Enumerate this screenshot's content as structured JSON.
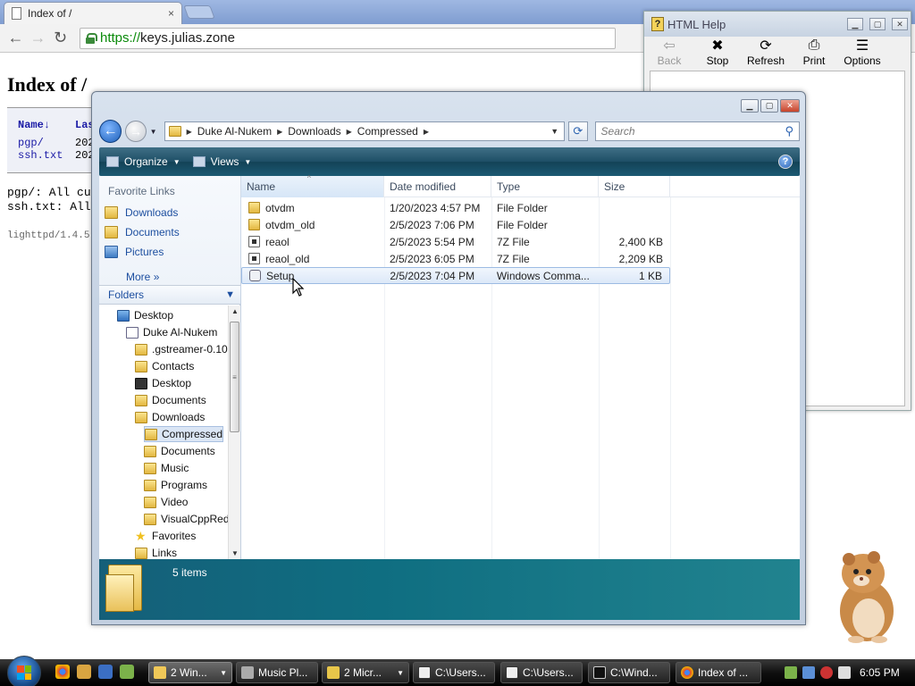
{
  "browser": {
    "tab_title": "Index of /",
    "tab_close": "×",
    "url_scheme": "https://",
    "url_host": "keys.julias.zone",
    "back_glyph": "←",
    "forward_glyph": "→",
    "reload_glyph": "↻"
  },
  "page": {
    "heading": "Index of /",
    "table_headers": [
      "Name↓",
      "Las"
    ],
    "rows": [
      {
        "name": "pgp/",
        "date": "202"
      },
      {
        "name": "ssh.txt",
        "date": "202"
      }
    ],
    "readme_lines": [
      "pgp/: All cu",
      "ssh.txt: All"
    ],
    "footer": "lighttpd/1.4.5"
  },
  "help_window": {
    "title": "HTML Help",
    "tools": [
      {
        "label": "Back",
        "icon": "back-arrow-icon",
        "glyph": "⇦",
        "enabled": false
      },
      {
        "label": "Stop",
        "icon": "stop-icon",
        "glyph": "✖",
        "enabled": true
      },
      {
        "label": "Refresh",
        "icon": "refresh-icon",
        "glyph": "⟳",
        "enabled": true
      },
      {
        "label": "Print",
        "icon": "print-icon",
        "glyph": "⎙",
        "enabled": true
      },
      {
        "label": "Options",
        "icon": "options-icon",
        "glyph": "☰",
        "enabled": true
      }
    ]
  },
  "explorer": {
    "breadcrumb": [
      "Duke Al-Nukem",
      "Downloads",
      "Compressed"
    ],
    "search_placeholder": "Search",
    "commands": {
      "organize": "Organize",
      "views": "Views"
    },
    "favorite_links_title": "Favorite Links",
    "favorite_links": [
      "Downloads",
      "Documents",
      "Pictures"
    ],
    "more_label": "More",
    "folders_label": "Folders",
    "tree": [
      {
        "label": "Desktop",
        "indent": 0,
        "icon": "desktop"
      },
      {
        "label": "Duke Al-Nukem",
        "indent": 1,
        "icon": "user"
      },
      {
        "label": ".gstreamer-0.10",
        "indent": 2,
        "icon": "folder"
      },
      {
        "label": "Contacts",
        "indent": 2,
        "icon": "folder"
      },
      {
        "label": "Desktop",
        "indent": 2,
        "icon": "dark"
      },
      {
        "label": "Documents",
        "indent": 2,
        "icon": "folder"
      },
      {
        "label": "Downloads",
        "indent": 2,
        "icon": "folder"
      },
      {
        "label": "Compressed",
        "indent": 3,
        "icon": "folder",
        "selected": true
      },
      {
        "label": "Documents",
        "indent": 3,
        "icon": "folder"
      },
      {
        "label": "Music",
        "indent": 3,
        "icon": "folder"
      },
      {
        "label": "Programs",
        "indent": 3,
        "icon": "folder"
      },
      {
        "label": "Video",
        "indent": 3,
        "icon": "folder"
      },
      {
        "label": "VisualCppRedist",
        "indent": 3,
        "icon": "folder"
      },
      {
        "label": "Favorites",
        "indent": 2,
        "icon": "star"
      },
      {
        "label": "Links",
        "indent": 2,
        "icon": "folder"
      }
    ],
    "columns": [
      "Name",
      "Date modified",
      "Type",
      "Size"
    ],
    "files": [
      {
        "name": "otvdm",
        "date": "1/20/2023 4:57 PM",
        "type": "File Folder",
        "size": "",
        "icon": "folder"
      },
      {
        "name": "otvdm_old",
        "date": "2/5/2023 7:06 PM",
        "type": "File Folder",
        "size": "",
        "icon": "folder"
      },
      {
        "name": "reaol",
        "date": "2/5/2023 5:54 PM",
        "type": "7Z File",
        "size": "2,400 KB",
        "icon": "archive"
      },
      {
        "name": "reaol_old",
        "date": "2/5/2023 6:05 PM",
        "type": "7Z File",
        "size": "2,209 KB",
        "icon": "archive"
      },
      {
        "name": "Setup",
        "date": "2/5/2023 7:04 PM",
        "type": "Windows Comma...",
        "size": "1 KB",
        "icon": "cmd",
        "selected": true
      }
    ],
    "item_count": "5 items"
  },
  "taskbar": {
    "buttons": [
      {
        "label": "2 Win...",
        "icon": "explorer-icon",
        "active": true,
        "group": true
      },
      {
        "label": "Music Pl...",
        "icon": "music-player-icon",
        "active": false,
        "group": false
      },
      {
        "label": "2 Micr...",
        "icon": "microsoft-icon",
        "active": false,
        "group": true
      },
      {
        "label": "C:\\Users...",
        "icon": "7zip-icon",
        "active": false,
        "group": false
      },
      {
        "label": "C:\\Users...",
        "icon": "7zip-icon",
        "active": false,
        "group": false
      },
      {
        "label": "C:\\Wind...",
        "icon": "console-icon",
        "active": false,
        "group": false
      },
      {
        "label": "Index of ...",
        "icon": "chrome-icon",
        "active": false,
        "group": false
      }
    ],
    "clock": "6:05 PM"
  }
}
